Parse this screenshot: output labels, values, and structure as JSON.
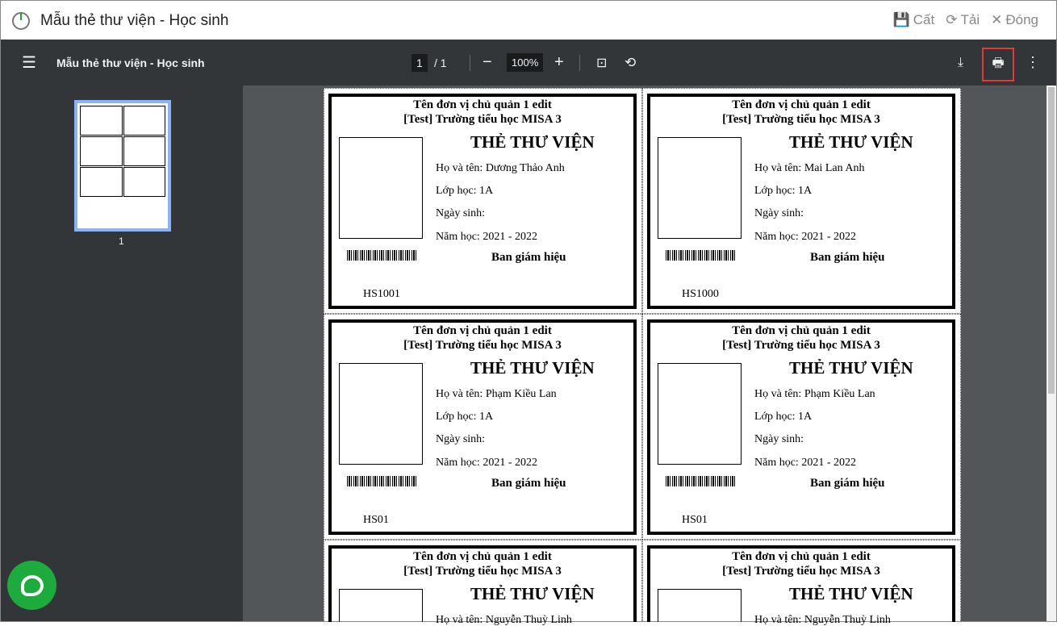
{
  "window": {
    "title": "Mẫu thẻ thư viện - Học sinh",
    "actions": [
      {
        "label": "Cất",
        "icon": "save-icon",
        "glyph": "💾"
      },
      {
        "label": "Tải",
        "icon": "reload-icon",
        "glyph": "⟳"
      },
      {
        "label": "Đóng",
        "icon": "close-icon",
        "glyph": "✕"
      }
    ]
  },
  "toolbar": {
    "title": "Mẫu thẻ thư viện - Học sinh",
    "page": "1",
    "page_total": "/  1",
    "zoom": "100%"
  },
  "sidebar": {
    "thumb_label": "1"
  },
  "cards": [
    {
      "unit": "Tên đơn vị chủ quản 1 edit",
      "school": "[Test] Trường tiểu học MISA 3",
      "heading": "THẺ THƯ VIỆN",
      "name": "Họ và tên: Dương Thảo Anh",
      "class": "Lớp học: 1A",
      "dob": "Ngày sinh:",
      "year": "Năm học: 2021 - 2022",
      "sign": "Ban giám hiệu",
      "code": "HS1001"
    },
    {
      "unit": "Tên đơn vị chủ quản 1 edit",
      "school": "[Test] Trường tiểu học MISA 3",
      "heading": "THẺ THƯ VIỆN",
      "name": "Họ và tên: Mai Lan Anh",
      "class": "Lớp học: 1A",
      "dob": "Ngày sinh:",
      "year": "Năm học: 2021 - 2022",
      "sign": "Ban giám hiệu",
      "code": "HS1000"
    },
    {
      "unit": "Tên đơn vị chủ quản 1 edit",
      "school": "[Test] Trường tiểu học MISA 3",
      "heading": "THẺ THƯ VIỆN",
      "name": "Họ và tên: Phạm Kiều Lan",
      "class": "Lớp học: 1A",
      "dob": "Ngày sinh:",
      "year": "Năm học: 2021 - 2022",
      "sign": "Ban giám hiệu",
      "code": "HS01"
    },
    {
      "unit": "Tên đơn vị chủ quản 1 edit",
      "school": "[Test] Trường tiểu học MISA 3",
      "heading": "THẺ THƯ VIỆN",
      "name": "Họ và tên: Phạm Kiều Lan",
      "class": "Lớp học: 1A",
      "dob": "Ngày sinh:",
      "year": "Năm học: 2021 - 2022",
      "sign": "Ban giám hiệu",
      "code": "HS01"
    },
    {
      "unit": "Tên đơn vị chủ quản 1 edit",
      "school": "[Test] Trường tiểu học MISA 3",
      "heading": "THẺ THƯ VIỆN",
      "name": "Họ và tên: Nguyễn Thuỳ Linh"
    },
    {
      "unit": "Tên đơn vị chủ quản 1 edit",
      "school": "[Test] Trường tiểu học MISA 3",
      "heading": "THẺ THƯ VIỆN",
      "name": "Họ và tên: Nguyễn Thuỳ Linh"
    }
  ]
}
